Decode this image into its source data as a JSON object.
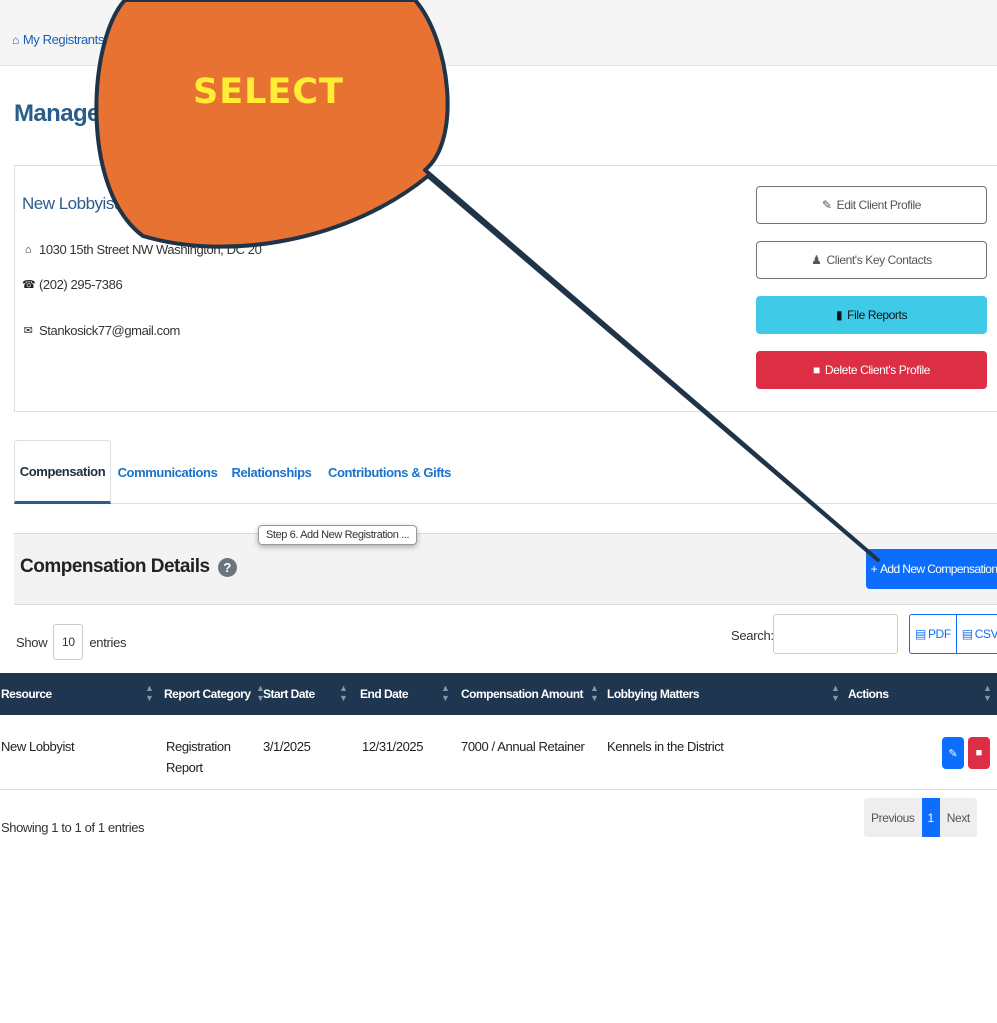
{
  "breadcrumb": {
    "home_label": "My Registrants"
  },
  "page": {
    "title": "Manage P"
  },
  "client": {
    "name": "New Lobbyist - Clien",
    "address": "1030 15th Street NW Washington, DC 20",
    "phone": "(202) 295-7386",
    "email": "Stankosick77@gmail.com"
  },
  "actions": {
    "edit": "Edit Client Profile",
    "contacts": "Client's Key Contacts",
    "file_reports": "File Reports",
    "delete": "Delete Client's Profile"
  },
  "tabs": [
    {
      "label": "Compensation",
      "active": true
    },
    {
      "label": "Communications"
    },
    {
      "label": "Relationships"
    },
    {
      "label": "Contributions & Gifts"
    }
  ],
  "panel": {
    "title": "Compensation Details",
    "help": "?",
    "add_button": "Add New Compensation",
    "tooltip": "Step 6.  Add New Registration ..."
  },
  "table_controls": {
    "show": "Show",
    "entries_value": "10",
    "entries": "entries",
    "search_label": "Search:",
    "pdf": "PDF",
    "csv": "CSV"
  },
  "table": {
    "columns": [
      "Resource",
      "Report Category",
      "Start Date",
      "End Date",
      "Compensation Amount",
      "Lobbying Matters",
      "Actions"
    ],
    "rows": [
      {
        "resource": "New Lobbyist",
        "category_line1": "Registration",
        "category_line2": "Report",
        "start": "3/1/2025",
        "end": "12/31/2025",
        "amount": "7000 / Annual Retainer",
        "matters": "Kennels in the District"
      }
    ]
  },
  "footer": {
    "showing": "Showing 1 to 1 of 1 entries",
    "previous": "Previous",
    "page": "1",
    "next": "Next"
  },
  "callout": {
    "label": "SELECT",
    "fill": "#e87232",
    "stroke": "#1f3448",
    "text_color": "#ffee33"
  },
  "colors": {
    "primary": "#0d6efd",
    "info": "#3fcbe8",
    "danger": "#dc2f46",
    "header": "#1e3650"
  }
}
